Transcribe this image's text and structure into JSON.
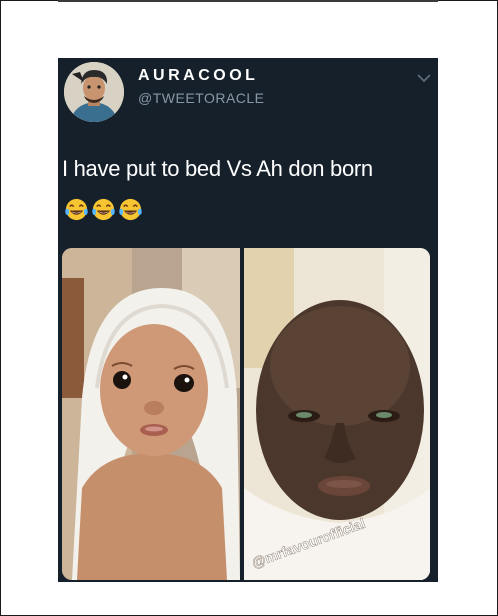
{
  "tweet": {
    "display_name": "AURACOOL",
    "handle": "@TWEETORACLE",
    "text": "I have put to bed Vs Ah don born",
    "emojis": [
      "face-with-tears-of-joy",
      "face-with-tears-of-joy",
      "face-with-tears-of-joy"
    ]
  },
  "media": {
    "watermark": "@mrfavourofficial"
  },
  "colors": {
    "tweet_background": "#15202b",
    "text": "#ffffff",
    "handle": "#8899a6",
    "page_background": "#ffffff"
  }
}
